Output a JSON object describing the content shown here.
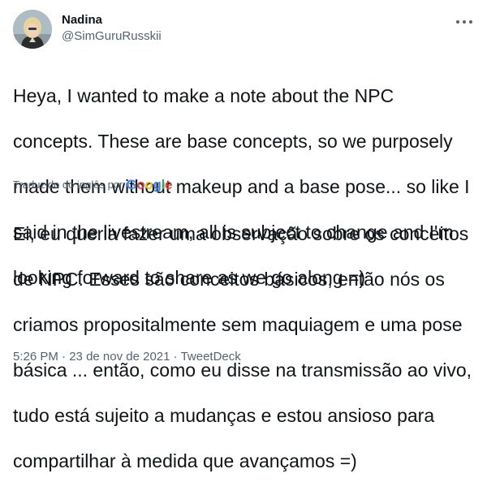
{
  "author": {
    "display_name": "Nadina",
    "handle": "@SimGuruRusskii"
  },
  "icons": {
    "more": "more-horizontal-icon"
  },
  "tweet": {
    "lines": [
      "Heya, I wanted to make a note about the NPC",
      "concepts. These are base concepts, so we purposely",
      "made them without makeup and a base pose... so like I",
      "said in the livestream, all is subject to change and I'm",
      "looking forward to share as we go along =)"
    ]
  },
  "translation": {
    "label": "Traduzido do inglês por",
    "provider": "Google",
    "lines": [
      "Ei, eu queria fazer uma observação sobre os conceitos",
      "de NPC. Esses são conceitos básicos, então nós os",
      "criamos propositalmente sem maquiagem e uma pose",
      "básica ... então, como eu disse na transmissão ao vivo,",
      "tudo está sujeito a mudanças e estou ansioso para",
      "compartilhar à medida que avançamos =)"
    ]
  },
  "meta": {
    "time": "5:26 PM",
    "separator": " · ",
    "date": "23 de nov de 2021",
    "source": "TweetDeck"
  },
  "colors": {
    "text": "#0f1419",
    "secondary": "#536471",
    "google_blue": "#4285F4",
    "google_red": "#EA4335",
    "google_yellow": "#FBBC05",
    "google_green": "#34A853"
  }
}
